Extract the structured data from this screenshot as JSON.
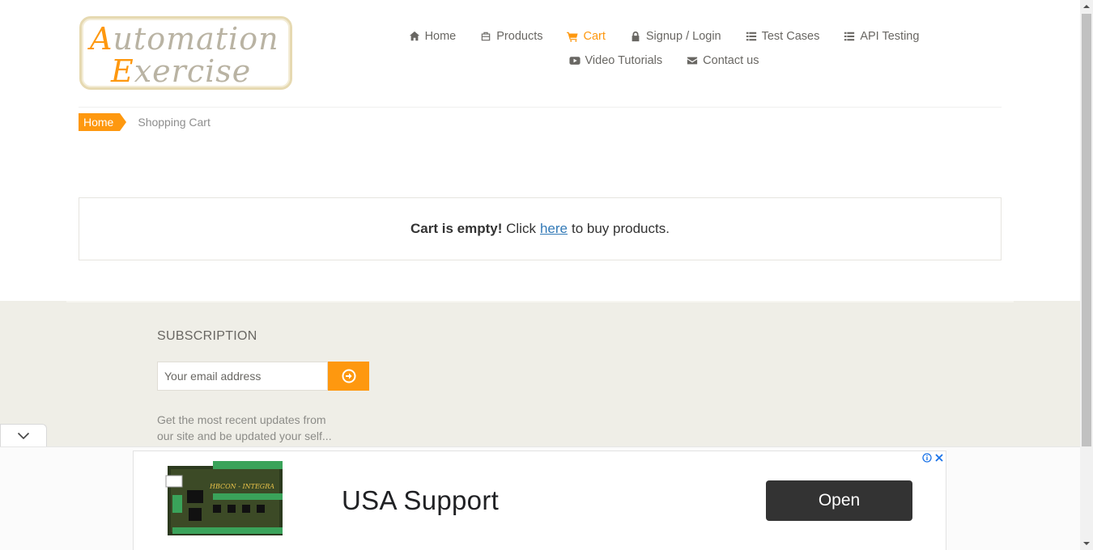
{
  "header": {
    "logo": {
      "line1_cap": "A",
      "line1_rest": "utomation",
      "line2_cap": "E",
      "line2_rest": "xercise"
    },
    "nav_row1": [
      {
        "label": "Home",
        "icon": "home-icon",
        "active": false
      },
      {
        "label": "Products",
        "icon": "products-icon",
        "active": false
      },
      {
        "label": "Cart",
        "icon": "cart-icon",
        "active": true
      },
      {
        "label": "Signup / Login",
        "icon": "lock-icon",
        "active": false
      },
      {
        "label": "Test Cases",
        "icon": "list-icon",
        "active": false
      },
      {
        "label": "API Testing",
        "icon": "list-icon",
        "active": false
      }
    ],
    "nav_row2": [
      {
        "label": "Video Tutorials",
        "icon": "youtube-icon",
        "active": false
      },
      {
        "label": "Contact us",
        "icon": "envelope-icon",
        "active": false
      }
    ]
  },
  "breadcrumb": {
    "home": "Home",
    "current": "Shopping Cart"
  },
  "cart": {
    "empty_bold": "Cart is empty!",
    "click": "Click",
    "link": "here",
    "suffix": "to buy products."
  },
  "footer": {
    "subscription_title": "SUBSCRIPTION",
    "email_placeholder": "Your email address",
    "subscription_text": "Get the most recent updates from our site and be updated your self..."
  },
  "ad": {
    "headline": "USA Support",
    "button": "Open",
    "product_label": "HBCON - INTEGRA"
  },
  "colors": {
    "accent": "#fe980f",
    "link": "#337ab7",
    "footer_bg": "#efeee7",
    "ad_button": "#333333"
  }
}
